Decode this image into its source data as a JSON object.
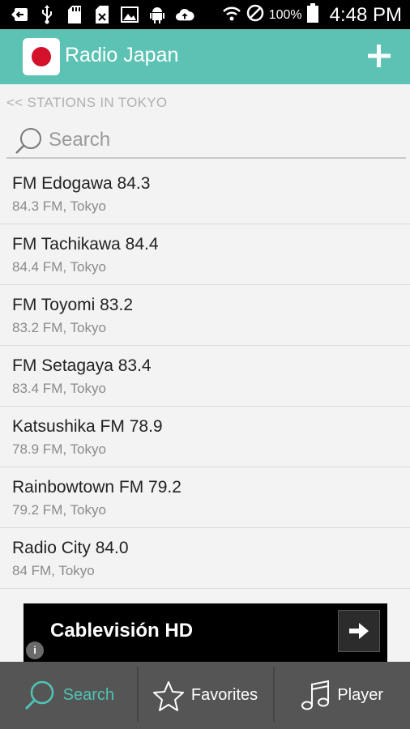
{
  "status_bar": {
    "battery_percent": "100%",
    "time": "4:48 PM",
    "icons": [
      "back-arrow-icon",
      "usb-icon",
      "sd-card-icon",
      "image-icon",
      "android-icon",
      "cloud-upload-icon",
      "wifi-icon",
      "do-not-disturb-icon",
      "battery-icon"
    ]
  },
  "app_bar": {
    "title": "Radio Japan",
    "logo_icon": "japan-flag-icon",
    "add_icon": "plus-icon",
    "color": "#5cc2b4"
  },
  "breadcrumb": "<< STATIONS IN TOKYO",
  "search": {
    "placeholder": "Search",
    "value": ""
  },
  "stations": [
    {
      "name": "FM Edogawa 84.3",
      "details": "84.3 FM, Tokyo"
    },
    {
      "name": "FM Tachikawa 84.4",
      "details": "84.4 FM, Tokyo"
    },
    {
      "name": "FM Toyomi 83.2",
      "details": "83.2 FM, Tokyo"
    },
    {
      "name": "FM Setagaya 83.4",
      "details": "83.4 FM, Tokyo"
    },
    {
      "name": "Katsushika FM 78.9",
      "details": "78.9 FM, Tokyo"
    },
    {
      "name": "Rainbowtown FM 79.2",
      "details": "79.2 FM, Tokyo"
    },
    {
      "name": "Radio City 84.0",
      "details": "84 FM, Tokyo"
    }
  ],
  "ad": {
    "title": "Cablevisión HD",
    "info_label": "i"
  },
  "tabs": [
    {
      "label": "Search",
      "icon": "search-icon",
      "active": true
    },
    {
      "label": "Favorites",
      "icon": "star-icon",
      "active": false
    },
    {
      "label": "Player",
      "icon": "music-note-icon",
      "active": false
    }
  ],
  "colors": {
    "accent": "#4fc4b4",
    "tab_bar": "#555555",
    "flag_red": "#d3112a"
  }
}
